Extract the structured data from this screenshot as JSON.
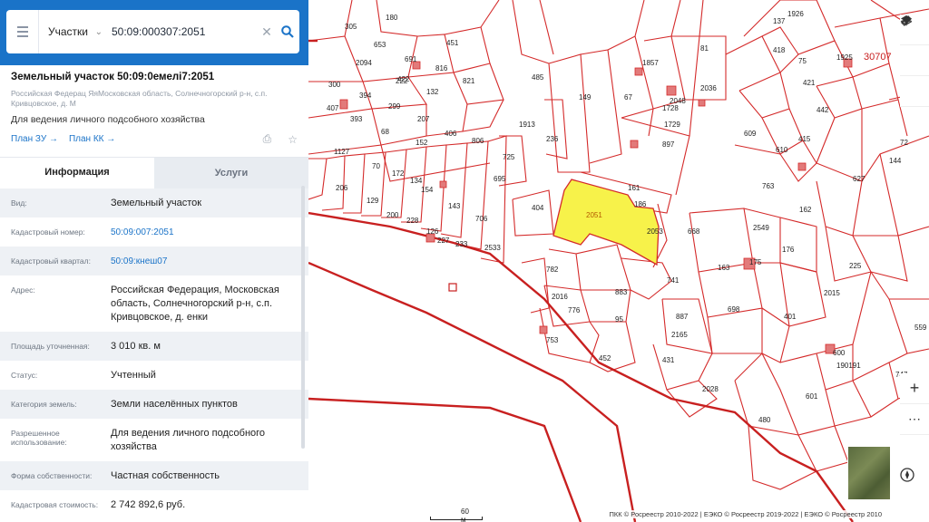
{
  "search": {
    "type_label": "Участки",
    "value": "50:09:00‍0307:2051"
  },
  "parcel": {
    "title": "Земельный участок 50:09:0емелі7:2051",
    "address": "Российская Федерац ЯяМосковская область, Солнечногорский р-н, с.п. Кривцовское, д. М",
    "use": "Для ведения личного подсобного хозяйства",
    "link_plan_zu": "План ЗУ →",
    "link_plan_kk": "План КК →"
  },
  "tabs": {
    "info": "Информация",
    "services": "Услуги"
  },
  "rows": [
    {
      "label": "Вид:",
      "value": "Земельный участок",
      "link": false
    },
    {
      "label": "Кадастровый номер:",
      "value": "50:09:0‍‍07:2051",
      "link": true
    },
    {
      "label": "Кадастровый квартал:",
      "value": "50:09:кнеш07",
      "link": true
    },
    {
      "label": "Адрес:",
      "value": "Российская Федерация, Московская область, Солнечногорский р-н, с.п. Кривцовское, д. енки",
      "link": false
    },
    {
      "label": "Площадь уточненная:",
      "value": "3 010 кв. м",
      "link": false
    },
    {
      "label": "Статус:",
      "value": "Учтенный",
      "link": false
    },
    {
      "label": "Категория земель:",
      "value": "Земли населённых пунктов",
      "link": false
    },
    {
      "label": "Разрешенное использование:",
      "value": "Для ведения личного подсобного хозяйства",
      "link": false
    },
    {
      "label": "Форма собственности:",
      "value": "Частная собственность",
      "link": false
    },
    {
      "label": "Кадастровая стоимость:",
      "value": "2 742 892,6 руб.",
      "link": false
    }
  ],
  "map": {
    "scale_label": "60 м",
    "attribution": "ПКК © Росреестр 2010-2022 | ЕЭКО © Росреестр 2019-2022 | ЕЭКО © Росреестр 2010",
    "selected_parcel": "2051",
    "quarter_label": "30707",
    "parcel_numbers": [
      "180",
      "305",
      "653",
      "451",
      "2094",
      "691",
      "816",
      "422",
      "485",
      "67",
      "1857",
      "81",
      "137",
      "1926",
      "418",
      "75",
      "1925",
      "300",
      "394",
      "222",
      "132",
      "821",
      "149",
      "2036",
      "2048",
      "421",
      "407",
      "393",
      "299",
      "207",
      "1913",
      "1728",
      "442",
      "415",
      "68",
      "406",
      "806",
      "236",
      "1729",
      "897",
      "610",
      "609",
      "152",
      "725",
      "1127",
      "70",
      "172",
      "134",
      "695",
      "161",
      "404",
      "186",
      "2053",
      "763",
      "627",
      "144",
      "206",
      "129",
      "200",
      "228",
      "154",
      "126",
      "143",
      "227",
      "233",
      "706",
      "2533",
      "668",
      "2549",
      "175",
      "162",
      "176",
      "225",
      "782",
      "883",
      "741",
      "163",
      "2015",
      "2016",
      "776",
      "95",
      "887",
      "698",
      "401",
      "2165",
      "600",
      "190191",
      "753",
      "452",
      "431",
      "2028",
      "601",
      "480",
      "747",
      "559",
      "72"
    ],
    "colors": {
      "parcel_line": "#d42a2a",
      "selected_fill": "#f7f24a",
      "header_blue": "#1a73c8"
    }
  },
  "icons": [
    "menu-icon",
    "chevron-down-icon",
    "clear-icon",
    "search-icon",
    "collapse-icon",
    "print-icon",
    "star-icon",
    "layers-icon",
    "ruler-icon",
    "location-icon",
    "zoom-in-icon",
    "more-icon",
    "compass-icon"
  ]
}
